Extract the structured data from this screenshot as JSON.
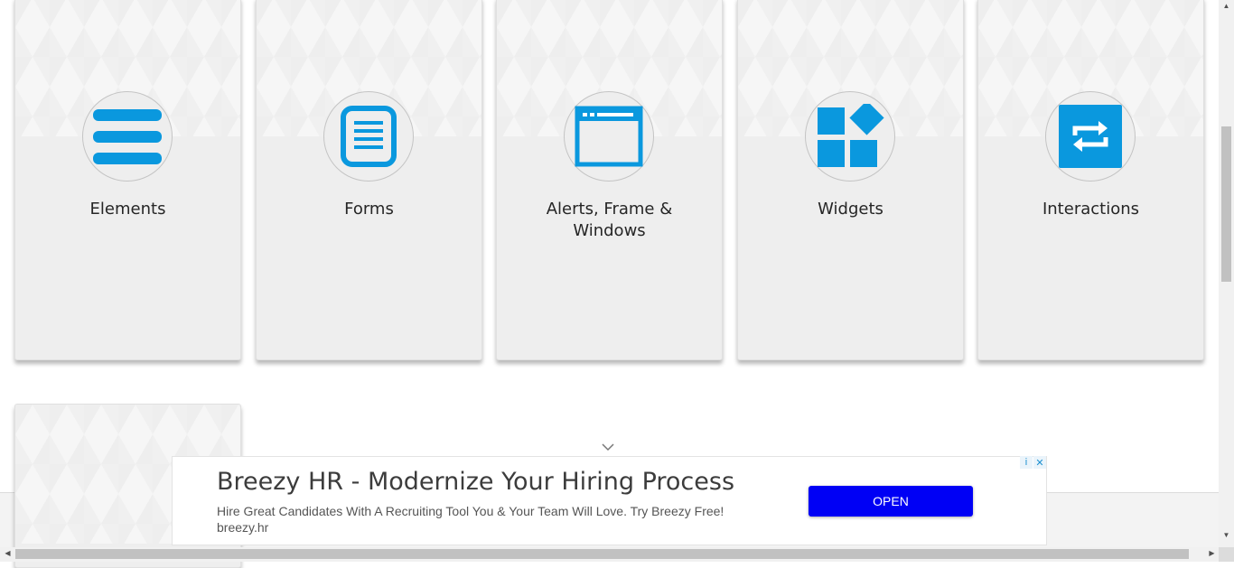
{
  "cards": [
    {
      "title": "Elements",
      "icon": "menu-lines-icon"
    },
    {
      "title": "Forms",
      "icon": "document-lines-icon"
    },
    {
      "title": "Alerts, Frame & Windows",
      "icon": "browser-window-icon"
    },
    {
      "title": "Widgets",
      "icon": "widgets-blocks-icon"
    },
    {
      "title": "Interactions",
      "icon": "swap-arrows-icon"
    }
  ],
  "ad": {
    "headline": "Breezy HR - Modernize Your Hiring Process",
    "description": "Hire Great Candidates With A Recruiting Tool You & Your Team Will Love. Try Breezy Free!",
    "url": "breezy.hr",
    "cta": "OPEN",
    "choices_info": "i",
    "choices_close": "✕"
  },
  "colors": {
    "icon_blue": "#0a98de",
    "cta_blue": "#0000f5",
    "card_bg": "#eeeeee"
  }
}
